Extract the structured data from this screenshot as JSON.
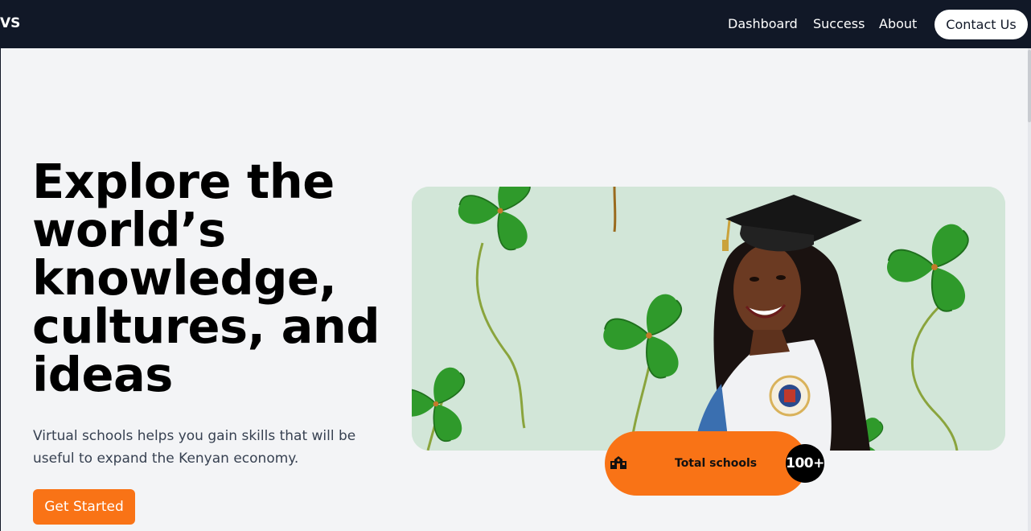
{
  "header": {
    "brand": "VS",
    "nav": [
      {
        "label": "Dashboard"
      },
      {
        "label": "Success"
      },
      {
        "label": "About"
      }
    ],
    "contact_label": "Contact Us"
  },
  "hero": {
    "title": "Explore the world’s knowledge, cultures, and ideas",
    "subtitle": "Virtual schools helps you gain skills that will be useful to expand the Kenyan economy.",
    "cta_label": "Get Started"
  },
  "stat": {
    "icon": "school-icon",
    "label": "Total schools",
    "value": "100+"
  },
  "colors": {
    "header_bg": "#111827",
    "accent": "#f97316",
    "page_bg": "#f3f4f6"
  }
}
